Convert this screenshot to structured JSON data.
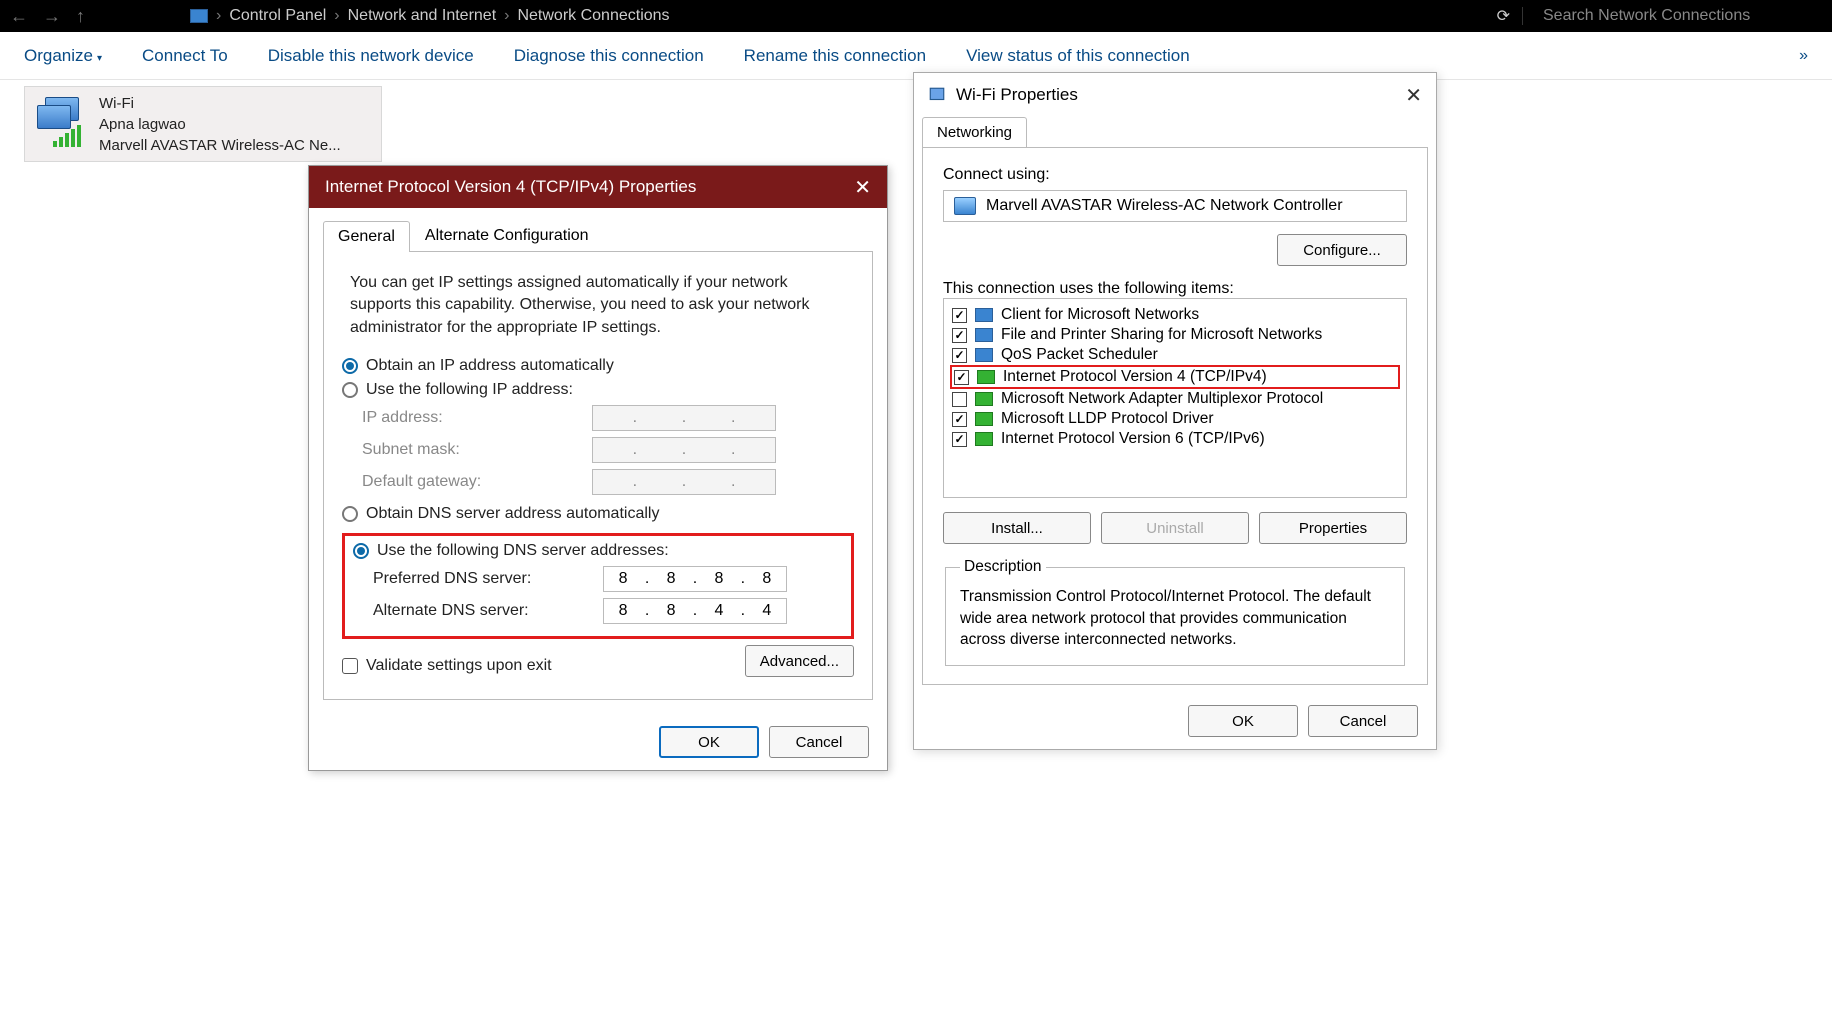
{
  "addrbar": {
    "crumb1": "Control Panel",
    "crumb2": "Network and Internet",
    "crumb3": "Network Connections",
    "searchPlaceholder": "Search Network Connections"
  },
  "cmdbar": {
    "organize": "Organize",
    "connectTo": "Connect To",
    "disable": "Disable this network device",
    "diagnose": "Diagnose this connection",
    "rename": "Rename this connection",
    "viewStatus": "View status of this connection"
  },
  "adapter": {
    "name": "Wi-Fi",
    "ssid": "Apna lagwao",
    "device": "Marvell AVASTAR Wireless-AC Ne..."
  },
  "ipv4": {
    "title": "Internet Protocol Version 4 (TCP/IPv4) Properties",
    "tabGeneral": "General",
    "tabAlt": "Alternate Configuration",
    "desc": "You can get IP settings assigned automatically if your network supports this capability. Otherwise, you need to ask your network administrator for the appropriate IP settings.",
    "radioAutoIP": "Obtain an IP address automatically",
    "radioUseIP": "Use the following IP address:",
    "lblIP": "IP address:",
    "lblMask": "Subnet mask:",
    "lblGw": "Default gateway:",
    "radioAutoDNS": "Obtain DNS server address automatically",
    "radioUseDNS": "Use the following DNS server addresses:",
    "lblPrefDNS": "Preferred DNS server:",
    "lblAltDNS": "Alternate DNS server:",
    "prefDNS": [
      "8",
      "8",
      "8",
      "8"
    ],
    "altDNS": [
      "8",
      "8",
      "4",
      "4"
    ],
    "validate": "Validate settings upon exit",
    "advanced": "Advanced...",
    "ok": "OK",
    "cancel": "Cancel"
  },
  "wifi": {
    "title": "Wi-Fi Properties",
    "tabNetworking": "Networking",
    "connectUsing": "Connect using:",
    "nic": "Marvell AVASTAR Wireless-AC Network Controller",
    "configure": "Configure...",
    "itemsLabel": "This connection uses the following items:",
    "items": [
      {
        "checked": true,
        "icon": "blue",
        "label": "Client for Microsoft Networks"
      },
      {
        "checked": true,
        "icon": "blue",
        "label": "File and Printer Sharing for Microsoft Networks"
      },
      {
        "checked": true,
        "icon": "blue",
        "label": "QoS Packet Scheduler"
      },
      {
        "checked": true,
        "icon": "green",
        "label": "Internet Protocol Version 4 (TCP/IPv4)",
        "highlight": true
      },
      {
        "checked": false,
        "icon": "green",
        "label": "Microsoft Network Adapter Multiplexor Protocol"
      },
      {
        "checked": true,
        "icon": "green",
        "label": "Microsoft LLDP Protocol Driver"
      },
      {
        "checked": true,
        "icon": "green",
        "label": "Internet Protocol Version 6 (TCP/IPv6)"
      }
    ],
    "install": "Install...",
    "uninstall": "Uninstall",
    "properties": "Properties",
    "descLegend": "Description",
    "descText": "Transmission Control Protocol/Internet Protocol. The default wide area network protocol that provides communication across diverse interconnected networks.",
    "ok": "OK",
    "cancel": "Cancel"
  }
}
